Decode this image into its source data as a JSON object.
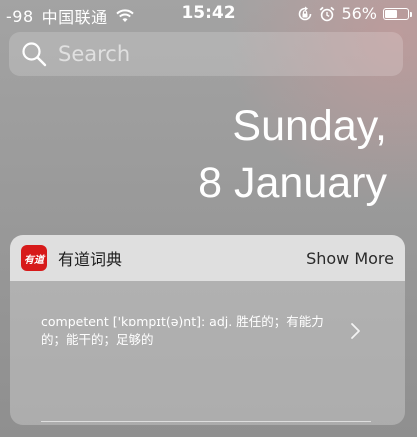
{
  "status_bar": {
    "signal": "-98",
    "carrier": "中国联通",
    "time": "15:42",
    "battery_percent": "56%",
    "battery_level": 0.56
  },
  "search": {
    "placeholder": "Search"
  },
  "date": {
    "day": "Sunday,",
    "date": "8 January"
  },
  "widget": {
    "app_icon_text": "有道",
    "title": "有道词典",
    "show_more_label": "Show More",
    "definition": "competent ['kɒmpɪt(ə)nt]: adj. 胜任的；有能力的；能干的；足够的"
  },
  "colors": {
    "app_icon": "#d71a1a"
  }
}
